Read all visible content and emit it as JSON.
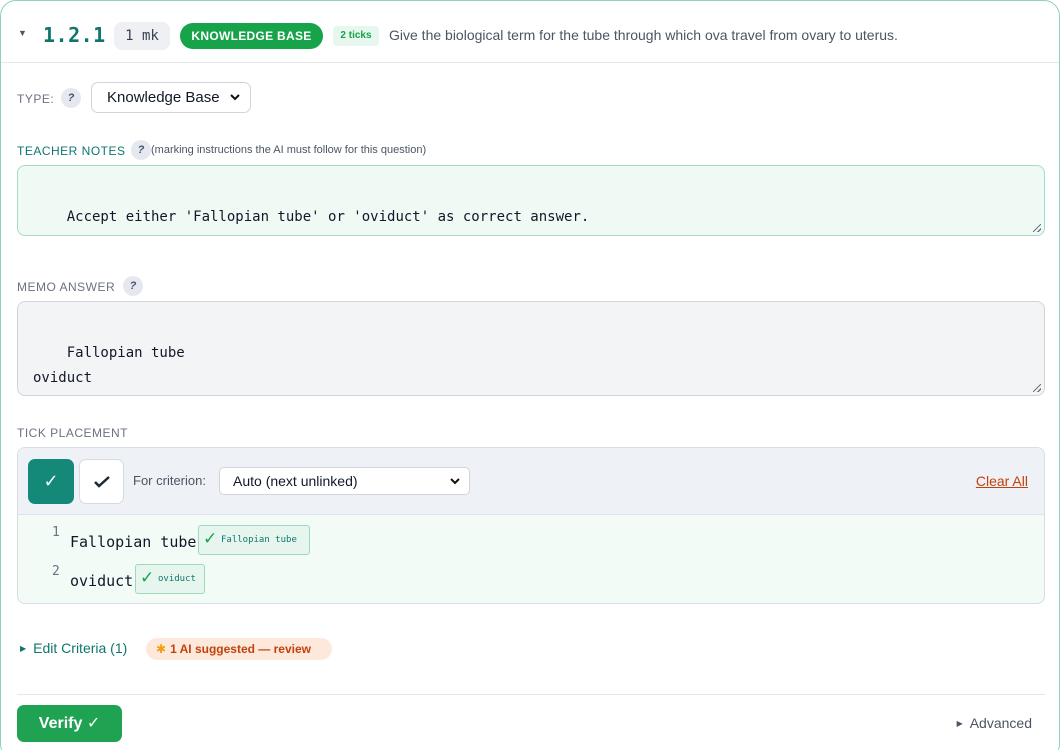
{
  "question": {
    "number": "1.2.1",
    "marks": "1 mk",
    "type_badge": "KNOWLEDGE BASE",
    "ticks_badge": "2 ticks",
    "text": "Give the biological term for the tube through which ova travel from ovary to uterus."
  },
  "type_field": {
    "label": "TYPE:",
    "help": "?",
    "selected": "Knowledge Base"
  },
  "teacher_notes": {
    "label": "TEACHER NOTES",
    "help": "?",
    "hint": "(marking instructions the AI must follow for this question)",
    "value": "Accept either 'Fallopian tube' or 'oviduct' as correct answer."
  },
  "memo_answer": {
    "label": "MEMO ANSWER",
    "help": "?",
    "value": "Fallopian tube\noviduct"
  },
  "tick_placement": {
    "label": "TICK PLACEMENT",
    "tick_on_symbol": "✓",
    "criterion_label": "For criterion:",
    "criterion_selected": "Auto (next unlinked)",
    "clear_all": "Clear All",
    "lines": [
      {
        "num": "1",
        "text": "Fallopian tube",
        "chip_check": "✓",
        "chip": "Fallopian tube"
      },
      {
        "num": "2",
        "text": "oviduct",
        "chip_check": "✓",
        "chip": "oviduct"
      }
    ]
  },
  "criteria": {
    "edit_label": "Edit Criteria (1)",
    "ai_badge": "1 AI suggested — review"
  },
  "footer": {
    "verify": "Verify ✓",
    "advanced": "Advanced"
  },
  "colors": {
    "accent_teal": "#0f766e",
    "success_green": "#16a34a",
    "warning_orange": "#c2410c"
  }
}
